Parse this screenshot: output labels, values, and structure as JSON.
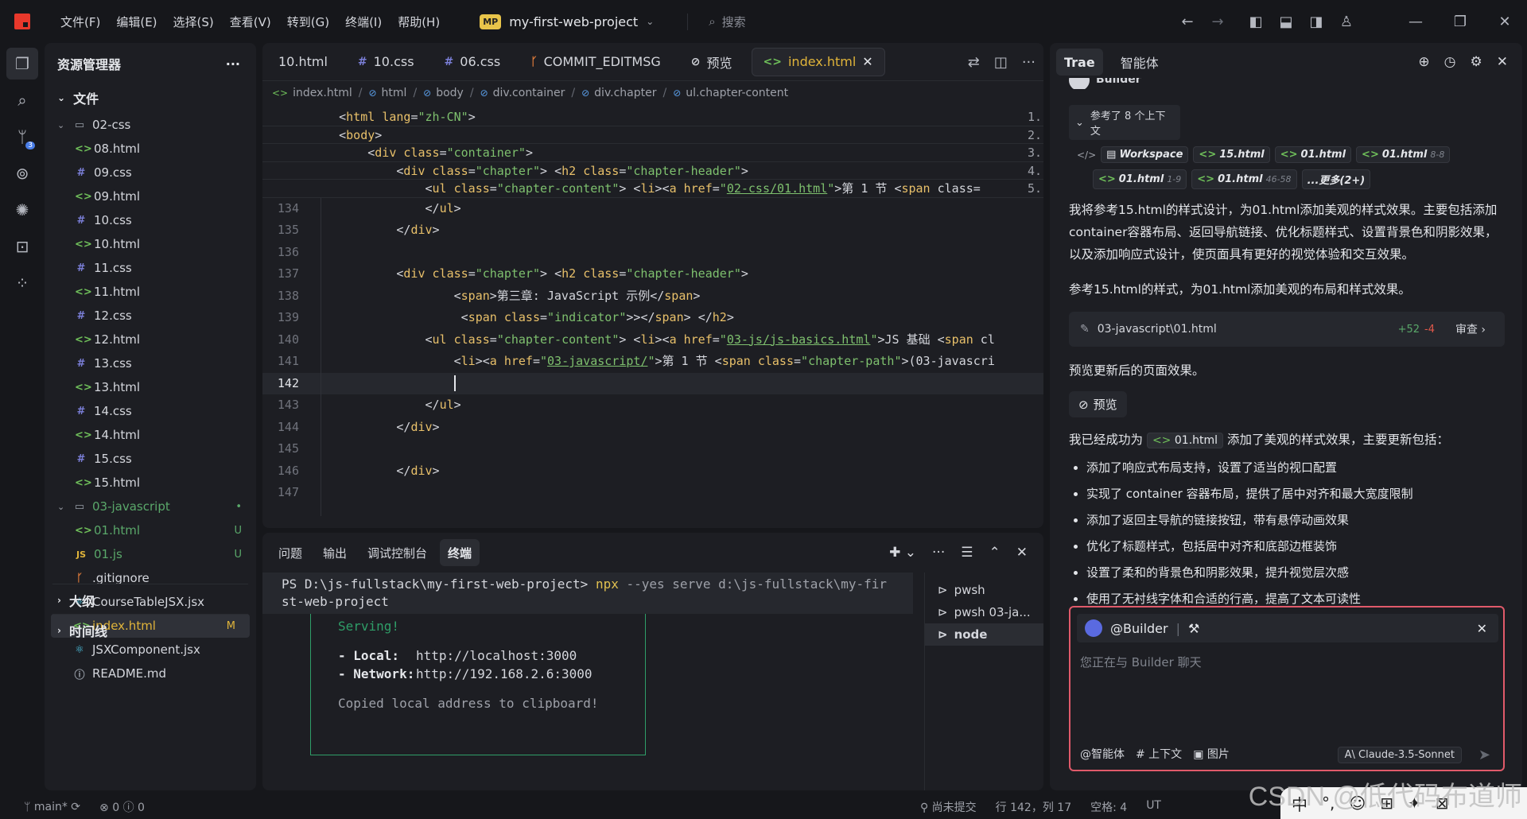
{
  "menu": [
    "文件(F)",
    "编辑(E)",
    "选择(S)",
    "查看(V)",
    "转到(G)",
    "终端(I)",
    "帮助(H)"
  ],
  "project": {
    "badge": "MP",
    "name": "my-first-web-project"
  },
  "search": {
    "label": "搜索"
  },
  "explorer": {
    "title": "资源管理器",
    "section": "文件",
    "rows": [
      {
        "label": "02-css",
        "type": "folder",
        "indent": 1,
        "open": true
      },
      {
        "label": "08.html",
        "type": "html",
        "indent": 2
      },
      {
        "label": "09.css",
        "type": "css",
        "indent": 2
      },
      {
        "label": "09.html",
        "type": "html",
        "indent": 2
      },
      {
        "label": "10.css",
        "type": "css",
        "indent": 2
      },
      {
        "label": "10.html",
        "type": "html",
        "indent": 2
      },
      {
        "label": "11.css",
        "type": "css",
        "indent": 2
      },
      {
        "label": "11.html",
        "type": "html",
        "indent": 2
      },
      {
        "label": "12.css",
        "type": "css",
        "indent": 2
      },
      {
        "label": "12.html",
        "type": "html",
        "indent": 2
      },
      {
        "label": "13.css",
        "type": "css",
        "indent": 2
      },
      {
        "label": "13.html",
        "type": "html",
        "indent": 2
      },
      {
        "label": "14.css",
        "type": "css",
        "indent": 2
      },
      {
        "label": "14.html",
        "type": "html",
        "indent": 2
      },
      {
        "label": "15.css",
        "type": "css",
        "indent": 2
      },
      {
        "label": "15.html",
        "type": "html",
        "indent": 2
      },
      {
        "label": "03-javascript",
        "type": "folder",
        "indent": 1,
        "open": true,
        "status": "green",
        "badge": "•"
      },
      {
        "label": "01.html",
        "type": "html",
        "indent": 2,
        "status": "green",
        "badge": "U"
      },
      {
        "label": "01.js",
        "type": "js",
        "indent": 2,
        "status": "green",
        "badge": "U"
      },
      {
        "label": ".gitignore",
        "type": "git",
        "indent": 1
      },
      {
        "label": "CourseTableJSX.jsx",
        "type": "react",
        "indent": 1
      },
      {
        "label": "index.html",
        "type": "html",
        "indent": 1,
        "status": "modified",
        "badge": "M",
        "selected": true
      },
      {
        "label": "JSXComponent.jsx",
        "type": "react",
        "indent": 1
      },
      {
        "label": "README.md",
        "type": "info",
        "indent": 1
      }
    ],
    "outline": "大纲",
    "timeline": "时间线"
  },
  "editor": {
    "tabs": [
      {
        "label": "10.html",
        "icon": ""
      },
      {
        "label": "10.css",
        "icon": "#"
      },
      {
        "label": "06.css",
        "icon": "#"
      },
      {
        "label": "COMMIT_EDITMSG",
        "icon": "ᚴ"
      },
      {
        "label": "预览",
        "icon": "⊘"
      },
      {
        "label": "index.html",
        "icon": "<>",
        "active": true
      }
    ],
    "breadcrumb": [
      "index.html",
      "html",
      "body",
      "div.container",
      "div.chapter",
      "ul.chapter-content"
    ],
    "sticky": [
      {
        "text": "<html lang=\"zh-CN\">",
        "indent": "    ",
        "mm": "1."
      },
      {
        "text": "<body>",
        "indent": "    ",
        "mm": "2."
      },
      {
        "text": "<div class=\"container\">",
        "indent": "        ",
        "mm": "3."
      },
      {
        "text": "<div class=\"chapter\"> <h2 class=\"chapter-header\">",
        "indent": "            ",
        "mm": "4."
      },
      {
        "text": "<ul class=\"chapter-content\"> <li><a href=\"02-css/01.html\">第 1 节 <span class=",
        "indent": "                ",
        "mm": "5."
      }
    ],
    "lines": [
      {
        "n": "134",
        "text": "                </ul>"
      },
      {
        "n": "135",
        "text": "            </div>"
      },
      {
        "n": "136",
        "text": ""
      },
      {
        "n": "137",
        "text": "            <div class=\"chapter\"> <h2 class=\"chapter-header\">"
      },
      {
        "n": "138",
        "text": "                    <span>第三章: JavaScript 示例</span>"
      },
      {
        "n": "139",
        "text": "                     <span class=\"indicator\">></span> </h2>"
      },
      {
        "n": "140",
        "text": "                <ul class=\"chapter-content\"> <li><a href=\"03-js/js-basics.html\">JS 基础 <span cl"
      },
      {
        "n": "141",
        "text": "                    <li><a href=\"03-javascript/\">第 1 节 <span class=\"chapter-path\">(03-javascri"
      },
      {
        "n": "142",
        "text": "                    ",
        "current": true
      },
      {
        "n": "143",
        "text": "                </ul>"
      },
      {
        "n": "144",
        "text": "            </div>"
      },
      {
        "n": "145",
        "text": ""
      },
      {
        "n": "146",
        "text": "            </div>"
      },
      {
        "n": "147",
        "text": ""
      }
    ]
  },
  "terminal": {
    "tabs": [
      "问题",
      "输出",
      "调试控制台",
      "终端"
    ],
    "active_tab": "终端",
    "prompt": "PS D:\\js-fullstack\\my-first-web-project>",
    "cmd": "npx",
    "args": "--yes serve d:\\js-fullstack\\my-fir",
    "args2": "st-web-project",
    "serving": "Serving!",
    "local_label": "- Local:",
    "local_url": "http://localhost:3000",
    "network_label": "- Network:",
    "network_url": "http://192.168.2.6:3000",
    "copied": "Copied local address to clipboard!",
    "sessions": [
      "pwsh",
      "pwsh 03-ja...",
      "node"
    ]
  },
  "chat": {
    "tabs": [
      "Trae",
      "智能体"
    ],
    "builder_partial": "Builder",
    "ref_head": "参考了 8 个上下文",
    "chips_row1": [
      {
        "label": "Workspace",
        "range": ""
      },
      {
        "label": "15.html",
        "range": ""
      },
      {
        "label": "01.html",
        "range": ""
      },
      {
        "label": "01.html",
        "range": "8-8"
      }
    ],
    "chips_row2": [
      {
        "label": "01.html",
        "range": "1-9"
      },
      {
        "label": "01.html",
        "range": "46-58"
      },
      {
        "label": "...更多(2+)",
        "range": ""
      }
    ],
    "p1": "我将参考15.html的样式设计，为01.html添加美观的样式效果。主要包括添加container容器布局、返回导航链接、优化标题样式、设置背景色和阴影效果，以及添加响应式设计，使页面具有更好的视觉体验和交互效果。",
    "p2": "参考15.html的样式，为01.html添加美观的布局和样式效果。",
    "file": {
      "path": "03-javascript\\01.html",
      "add": "+52",
      "del": "-4",
      "review": "审查"
    },
    "p3": "预览更新后的页面效果。",
    "preview_btn": "预览",
    "p4_pre": "我已经成功为",
    "p4_file": "01.html",
    "p4_post": "添加了美观的样式效果，主要更新包括：",
    "bullets": [
      "添加了响应式布局支持，设置了适当的视口配置",
      "实现了 container 容器布局，提供了居中对齐和最大宽度限制",
      "添加了返回主导航的链接按钮，带有悬停动画效果",
      "优化了标题样式，包括居中对齐和底部边框装饰",
      "设置了柔和的背景色和阴影效果，提升视觉层次感",
      "使用了无衬线字体和合适的行高，提高了文本可读性"
    ],
    "input": {
      "agent": "@Builder",
      "placeholder": "您正在与 Builder 聊天",
      "agent_btn": "@智能体",
      "context_btn": "# 上下文",
      "image_btn": "图片",
      "model": "Claude-3.5-Sonnet"
    }
  },
  "status": {
    "branch": "main*",
    "errors": "0",
    "warnings": "0",
    "uncommitted": "尚未提交",
    "position": "行 142，列 17",
    "spaces": "空格: 4",
    "encoding": "UT",
    "watermark": "CSDN @低代码布道师"
  },
  "ime": [
    "中",
    "°,",
    "☺",
    "⊞",
    "✦",
    "⊠"
  ]
}
